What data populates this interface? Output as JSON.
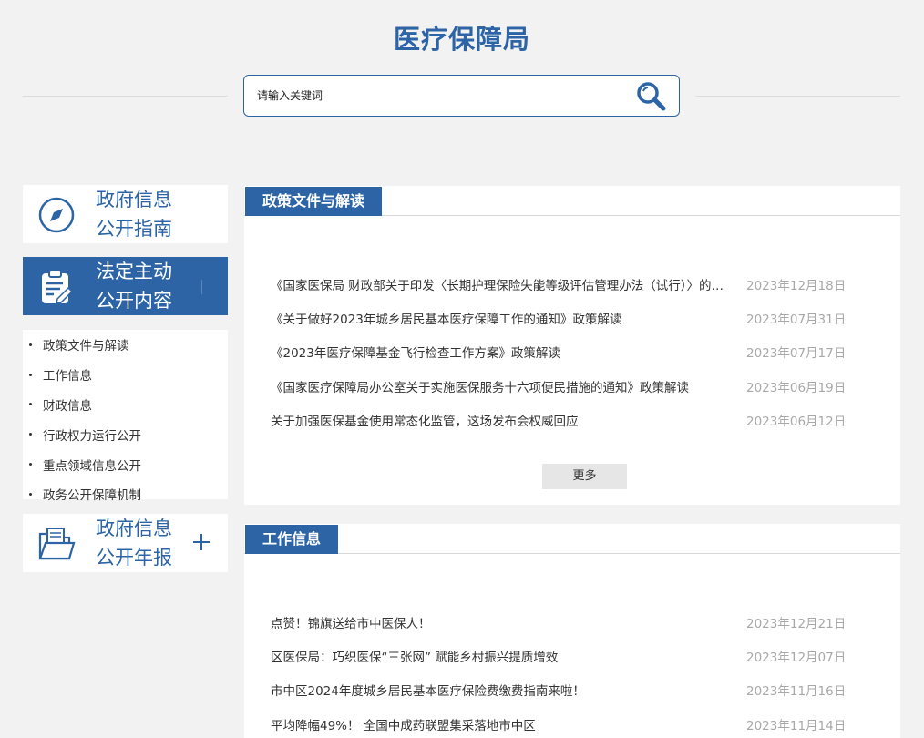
{
  "header": {
    "site_title": "医疗保障局",
    "search_placeholder": "请输入关键词"
  },
  "sidebar": {
    "cards": [
      {
        "line1": "政府信息",
        "line2": "公开指南",
        "icon": "compass-icon"
      },
      {
        "line1": "法定主动",
        "line2": "公开内容",
        "icon": "clipboard-icon",
        "active": true
      },
      {
        "line1": "政府信息",
        "line2": "公开年报",
        "icon": "folder-icon"
      }
    ],
    "sub_items": [
      "政策文件与解读",
      "工作信息",
      "财政信息",
      "行政权力运行公开",
      "重点领域信息公开",
      "政务公开保障机制"
    ]
  },
  "policy_section": {
    "tab_label": "政策文件与解读",
    "items": [
      {
        "title": "《国家医保局 财政部关于印发〈长期护理保险失能等级评估管理办法（试行）〉的通知》政策解读",
        "date": "2023年12月18日"
      },
      {
        "title": "《关于做好2023年城乡居民基本医疗保障工作的通知》政策解读",
        "date": "2023年07月31日"
      },
      {
        "title": "《2023年医疗保障基金飞行检查工作方案》政策解读",
        "date": "2023年07月17日"
      },
      {
        "title": "《国家医疗保障局办公室关于实施医保服务十六项便民措施的通知》政策解读",
        "date": "2023年06月19日"
      },
      {
        "title": "关于加强医保基金使用常态化监管，这场发布会权威回应",
        "date": "2023年06月12日"
      }
    ],
    "more_label": "更多"
  },
  "work_section": {
    "tab_label": "工作信息",
    "items": [
      {
        "title": "点赞！锦旗送给市中医保人！",
        "date": "2023年12月21日"
      },
      {
        "title": "区医保局：巧织医保“三张网” 赋能乡村振兴提质增效",
        "date": "2023年12月07日"
      },
      {
        "title": "市中区2024年度城乡居民基本医疗保险费缴费指南来啦！",
        "date": "2023年11月16日"
      },
      {
        "title": "平均降幅49%！ 全国中成药联盟集采落地市中区",
        "date": "2023年11月14日"
      }
    ]
  },
  "colors": {
    "brand_blue": "#2c64a6",
    "background": "#f2f2f2",
    "date_gray": "#a8a8a8"
  }
}
